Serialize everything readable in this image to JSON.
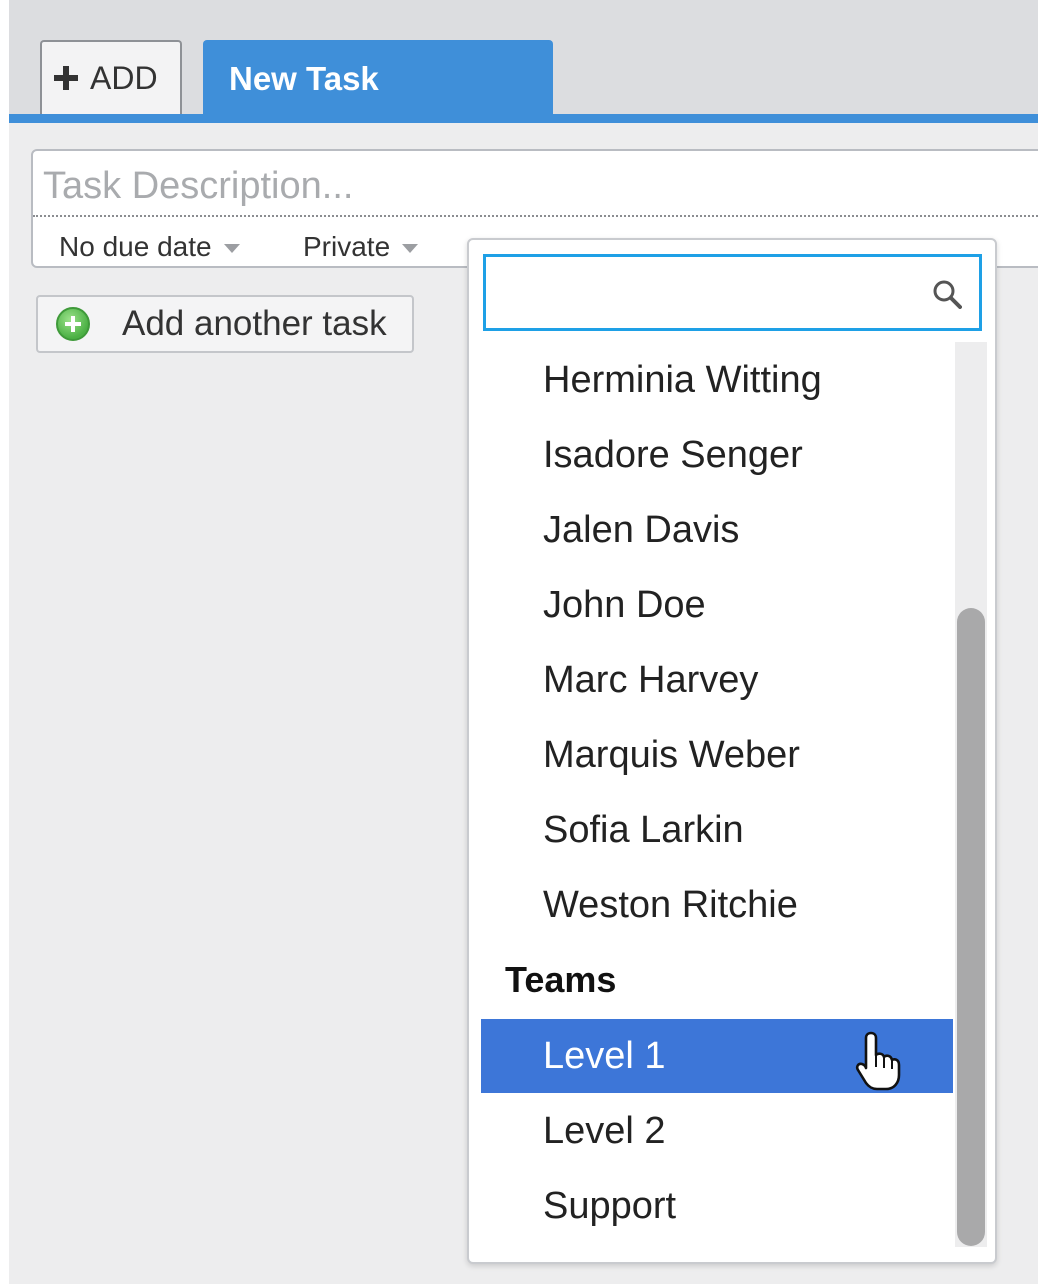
{
  "tabs": {
    "add_label": "ADD",
    "active_label": "New Task"
  },
  "task": {
    "placeholder": "Task Description...",
    "due_date": "No due date",
    "privacy": "Private"
  },
  "add_another_label": "Add another task",
  "dropdown": {
    "search_value": "",
    "people": [
      "Herminia Witting",
      "Isadore Senger",
      "Jalen Davis",
      "John Doe",
      "Marc Harvey",
      "Marquis Weber",
      "Sofia Larkin",
      "Weston Ritchie"
    ],
    "group_label": "Teams",
    "teams": [
      "Level 1",
      "Level 2",
      "Support"
    ],
    "highlighted": "Level 1"
  },
  "colors": {
    "accent": "#3f8fd9",
    "highlight": "#3d76d8",
    "search_border": "#1ea0e6"
  },
  "icons": [
    "plus-icon",
    "add-task-plus-icon",
    "caret-down-icon",
    "search-icon",
    "hand-cursor-icon"
  ]
}
